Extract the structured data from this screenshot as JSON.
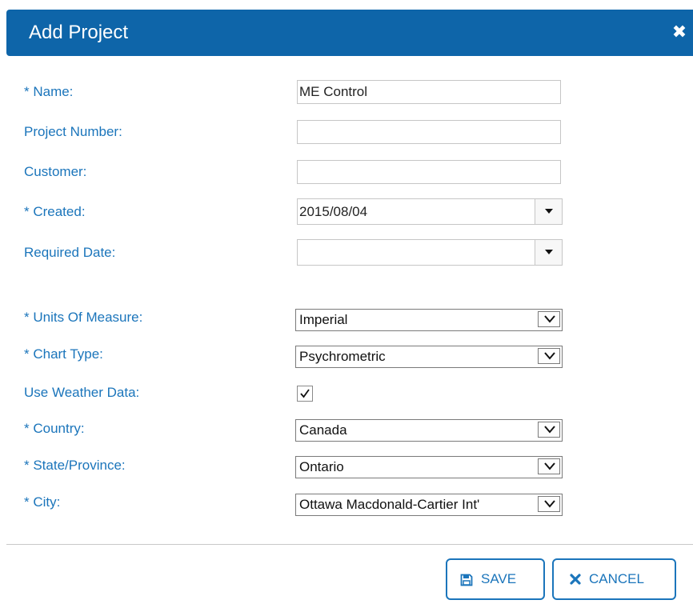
{
  "dialog": {
    "title": "Add Project",
    "close_icon": "close-icon"
  },
  "form": {
    "name": {
      "label": "* Name:",
      "value": "ME Control"
    },
    "project_number": {
      "label": "Project Number:",
      "value": ""
    },
    "customer": {
      "label": "Customer:",
      "value": ""
    },
    "created": {
      "label": "* Created:",
      "value": "2015/08/04"
    },
    "required_date": {
      "label": "Required Date:",
      "value": ""
    },
    "units_of_measure": {
      "label": "* Units Of Measure:",
      "value": "Imperial"
    },
    "chart_type": {
      "label": "* Chart Type:",
      "value": "Psychrometric"
    },
    "use_weather_data": {
      "label": "Use Weather Data:",
      "checked": true
    },
    "country": {
      "label": "* Country:",
      "value": "Canada"
    },
    "state_province": {
      "label": "* State/Province:",
      "value": "Ontario"
    },
    "city": {
      "label": "* City:",
      "value": "Ottawa Macdonald-Cartier Int'"
    }
  },
  "actions": {
    "save": {
      "label": "SAVE",
      "icon": "floppy-disk-icon"
    },
    "cancel": {
      "label": "CANCEL",
      "icon": "x-icon"
    }
  },
  "colors": {
    "header_background": "#0e65a9",
    "label_text": "#1b75bb",
    "button_border": "#1b75bb"
  }
}
